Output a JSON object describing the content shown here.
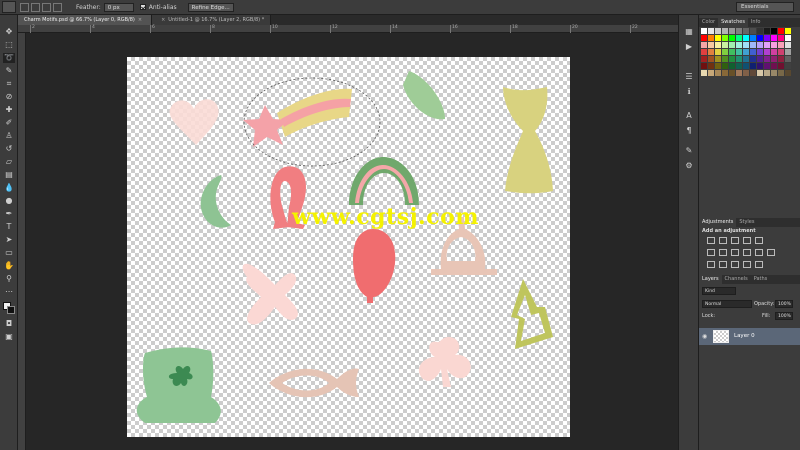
{
  "options_bar": {
    "feather_label": "Feather:",
    "feather_value": "0 px",
    "anti_alias_label": "Anti-alias",
    "refine_edge_label": "Refine Edge...",
    "workspace": "Essentials"
  },
  "tabs": [
    {
      "title": "Charm Motifs.psd @ 66.7% (Layer 0, RGB/8)",
      "close": "×"
    },
    {
      "title": "Untitled-1 @ 16.7% (Layer 2, RGB/8) *",
      "close": "×"
    }
  ],
  "ruler_labels": [
    "2",
    "4",
    "6",
    "8",
    "10",
    "12",
    "14",
    "16",
    "18",
    "20",
    "22"
  ],
  "watermark": "www.cgtsj.com",
  "panels": {
    "color_tabs": [
      "Color",
      "Swatches",
      "Info"
    ],
    "adjust_tabs": [
      "Adjustments",
      "Styles"
    ],
    "add_adjustment": "Add an adjustment",
    "layers_tabs": [
      "Layers",
      "Channels",
      "Paths"
    ],
    "kind_label": "Kind",
    "blend_mode": "Normal",
    "opacity_label": "Opacity:",
    "opacity_value": "100%",
    "lock_label": "Lock:",
    "fill_label": "Fill:",
    "fill_value": "100%",
    "layer_name": "Layer 0"
  },
  "swatch_colors": [
    "#ffffff",
    "#e6e6e6",
    "#cccccc",
    "#b3b3b3",
    "#999999",
    "#808080",
    "#666666",
    "#4d4d4d",
    "#333333",
    "#1a1a1a",
    "#000000",
    "#ff0000",
    "#ffff00",
    "#ff0000",
    "#ff7f00",
    "#ffff00",
    "#7fff00",
    "#00ff00",
    "#00ff7f",
    "#00ffff",
    "#007fff",
    "#0000ff",
    "#7f00ff",
    "#ff00ff",
    "#ff007f",
    "#ffffff",
    "#f4a6a6",
    "#f8c9a0",
    "#f9f1a0",
    "#c9f0a0",
    "#a0f0b0",
    "#a0f0e0",
    "#a0e0f8",
    "#a0b8f8",
    "#b8a0f8",
    "#e0a0f8",
    "#f8a0e0",
    "#f8a0b8",
    "#e0e0e0",
    "#e04040",
    "#e08040",
    "#e0d040",
    "#80d040",
    "#40c060",
    "#40c0a0",
    "#40a0d0",
    "#4060d0",
    "#7040d0",
    "#b040d0",
    "#d040a0",
    "#d04070",
    "#a0a0a0",
    "#a02020",
    "#a05020",
    "#a09020",
    "#509020",
    "#209040",
    "#209070",
    "#207090",
    "#203090",
    "#502090",
    "#802090",
    "#902070",
    "#902040",
    "#606060",
    "#701010",
    "#703010",
    "#706010",
    "#306010",
    "#106030",
    "#106050",
    "#105070",
    "#102070",
    "#301070",
    "#601070",
    "#701050",
    "#701030",
    "#404040",
    "#e8d8b0",
    "#c8a878",
    "#a88858",
    "#886838",
    "#685028",
    "#a0785a",
    "#806048",
    "#604838",
    "#d8c8a8",
    "#b8a888",
    "#988868",
    "#786848",
    "#584830"
  ]
}
